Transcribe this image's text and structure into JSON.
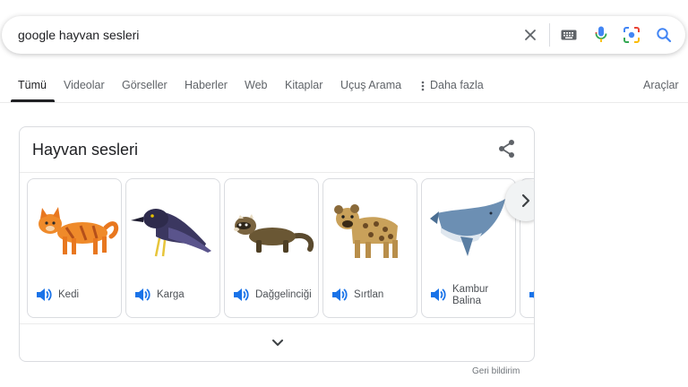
{
  "search": {
    "query": "google hayvan sesleri"
  },
  "tabs": [
    {
      "label": "Tümü"
    },
    {
      "label": "Videolar"
    },
    {
      "label": "Görseller"
    },
    {
      "label": "Haberler"
    },
    {
      "label": "Web"
    },
    {
      "label": "Kitaplar"
    },
    {
      "label": "Uçuş Arama"
    },
    {
      "label": "Daha fazla"
    }
  ],
  "tools_label": "Araçlar",
  "card": {
    "title": "Hayvan sesleri",
    "animals": [
      {
        "name": "Kedi"
      },
      {
        "name": "Karga"
      },
      {
        "name": "Dağgelinciği"
      },
      {
        "name": "Sırtlan"
      },
      {
        "name_line1": "Kambur",
        "name_line2": "Balina"
      }
    ]
  },
  "feedback": "Geri bildirim",
  "colors": {
    "google_blue": "#1a73e8",
    "text": "#202124",
    "secondary": "#5f6368"
  },
  "icons": [
    "clear-icon",
    "keyboard-icon",
    "mic-icon",
    "lens-icon",
    "search-icon",
    "share-icon",
    "speaker-icon",
    "chevron-right-icon",
    "chevron-down-icon",
    "more-vert-icon"
  ]
}
